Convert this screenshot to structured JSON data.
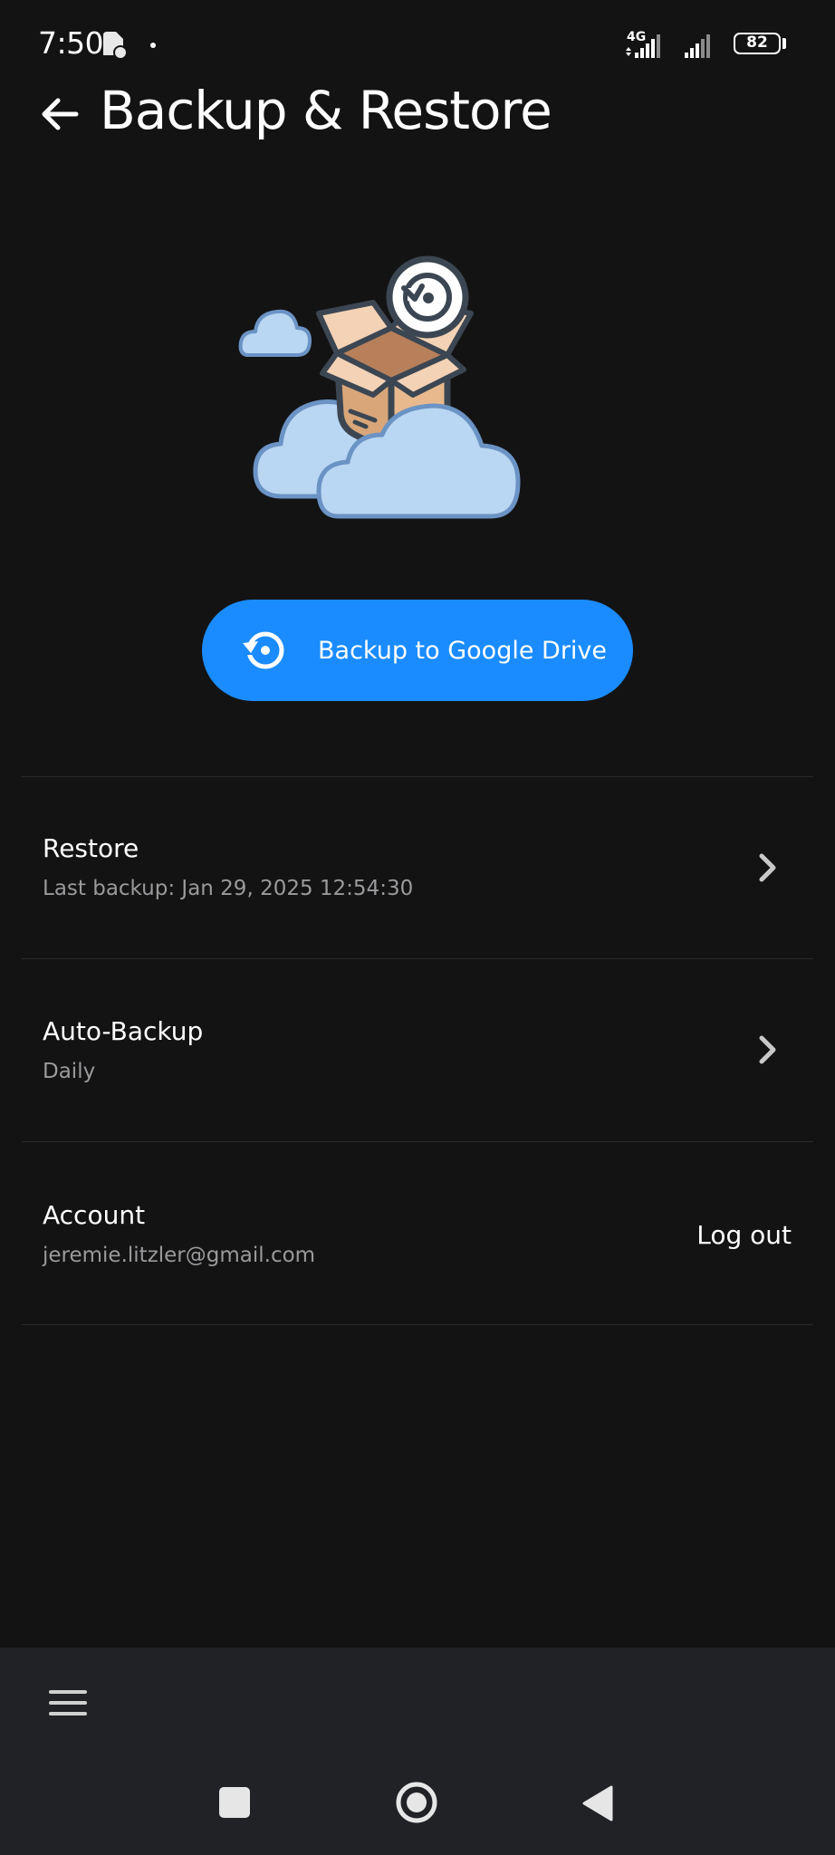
{
  "status_bar": {
    "time": "7:50",
    "network": "4G",
    "battery": "82"
  },
  "header": {
    "title": "Backup & Restore"
  },
  "backup_button": {
    "label": "Backup to Google Drive"
  },
  "list": {
    "restore": {
      "title": "Restore",
      "subtitle": "Last backup: Jan 29, 2025  12:54:30"
    },
    "auto_backup": {
      "title": "Auto-Backup",
      "subtitle": "Daily"
    },
    "account": {
      "title": "Account",
      "subtitle": "jeremie.litzler@gmail.com",
      "action_label": "Log out"
    }
  },
  "colors": {
    "background": "#131314",
    "accent": "#1a8cff",
    "secondary_text": "#9a9a9c",
    "bottom_bar": "#212226"
  },
  "icons": {
    "back": "arrow-left-icon",
    "backup": "restore-clock-icon",
    "chevron": "chevron-right-icon",
    "menu": "hamburger-menu-icon"
  }
}
